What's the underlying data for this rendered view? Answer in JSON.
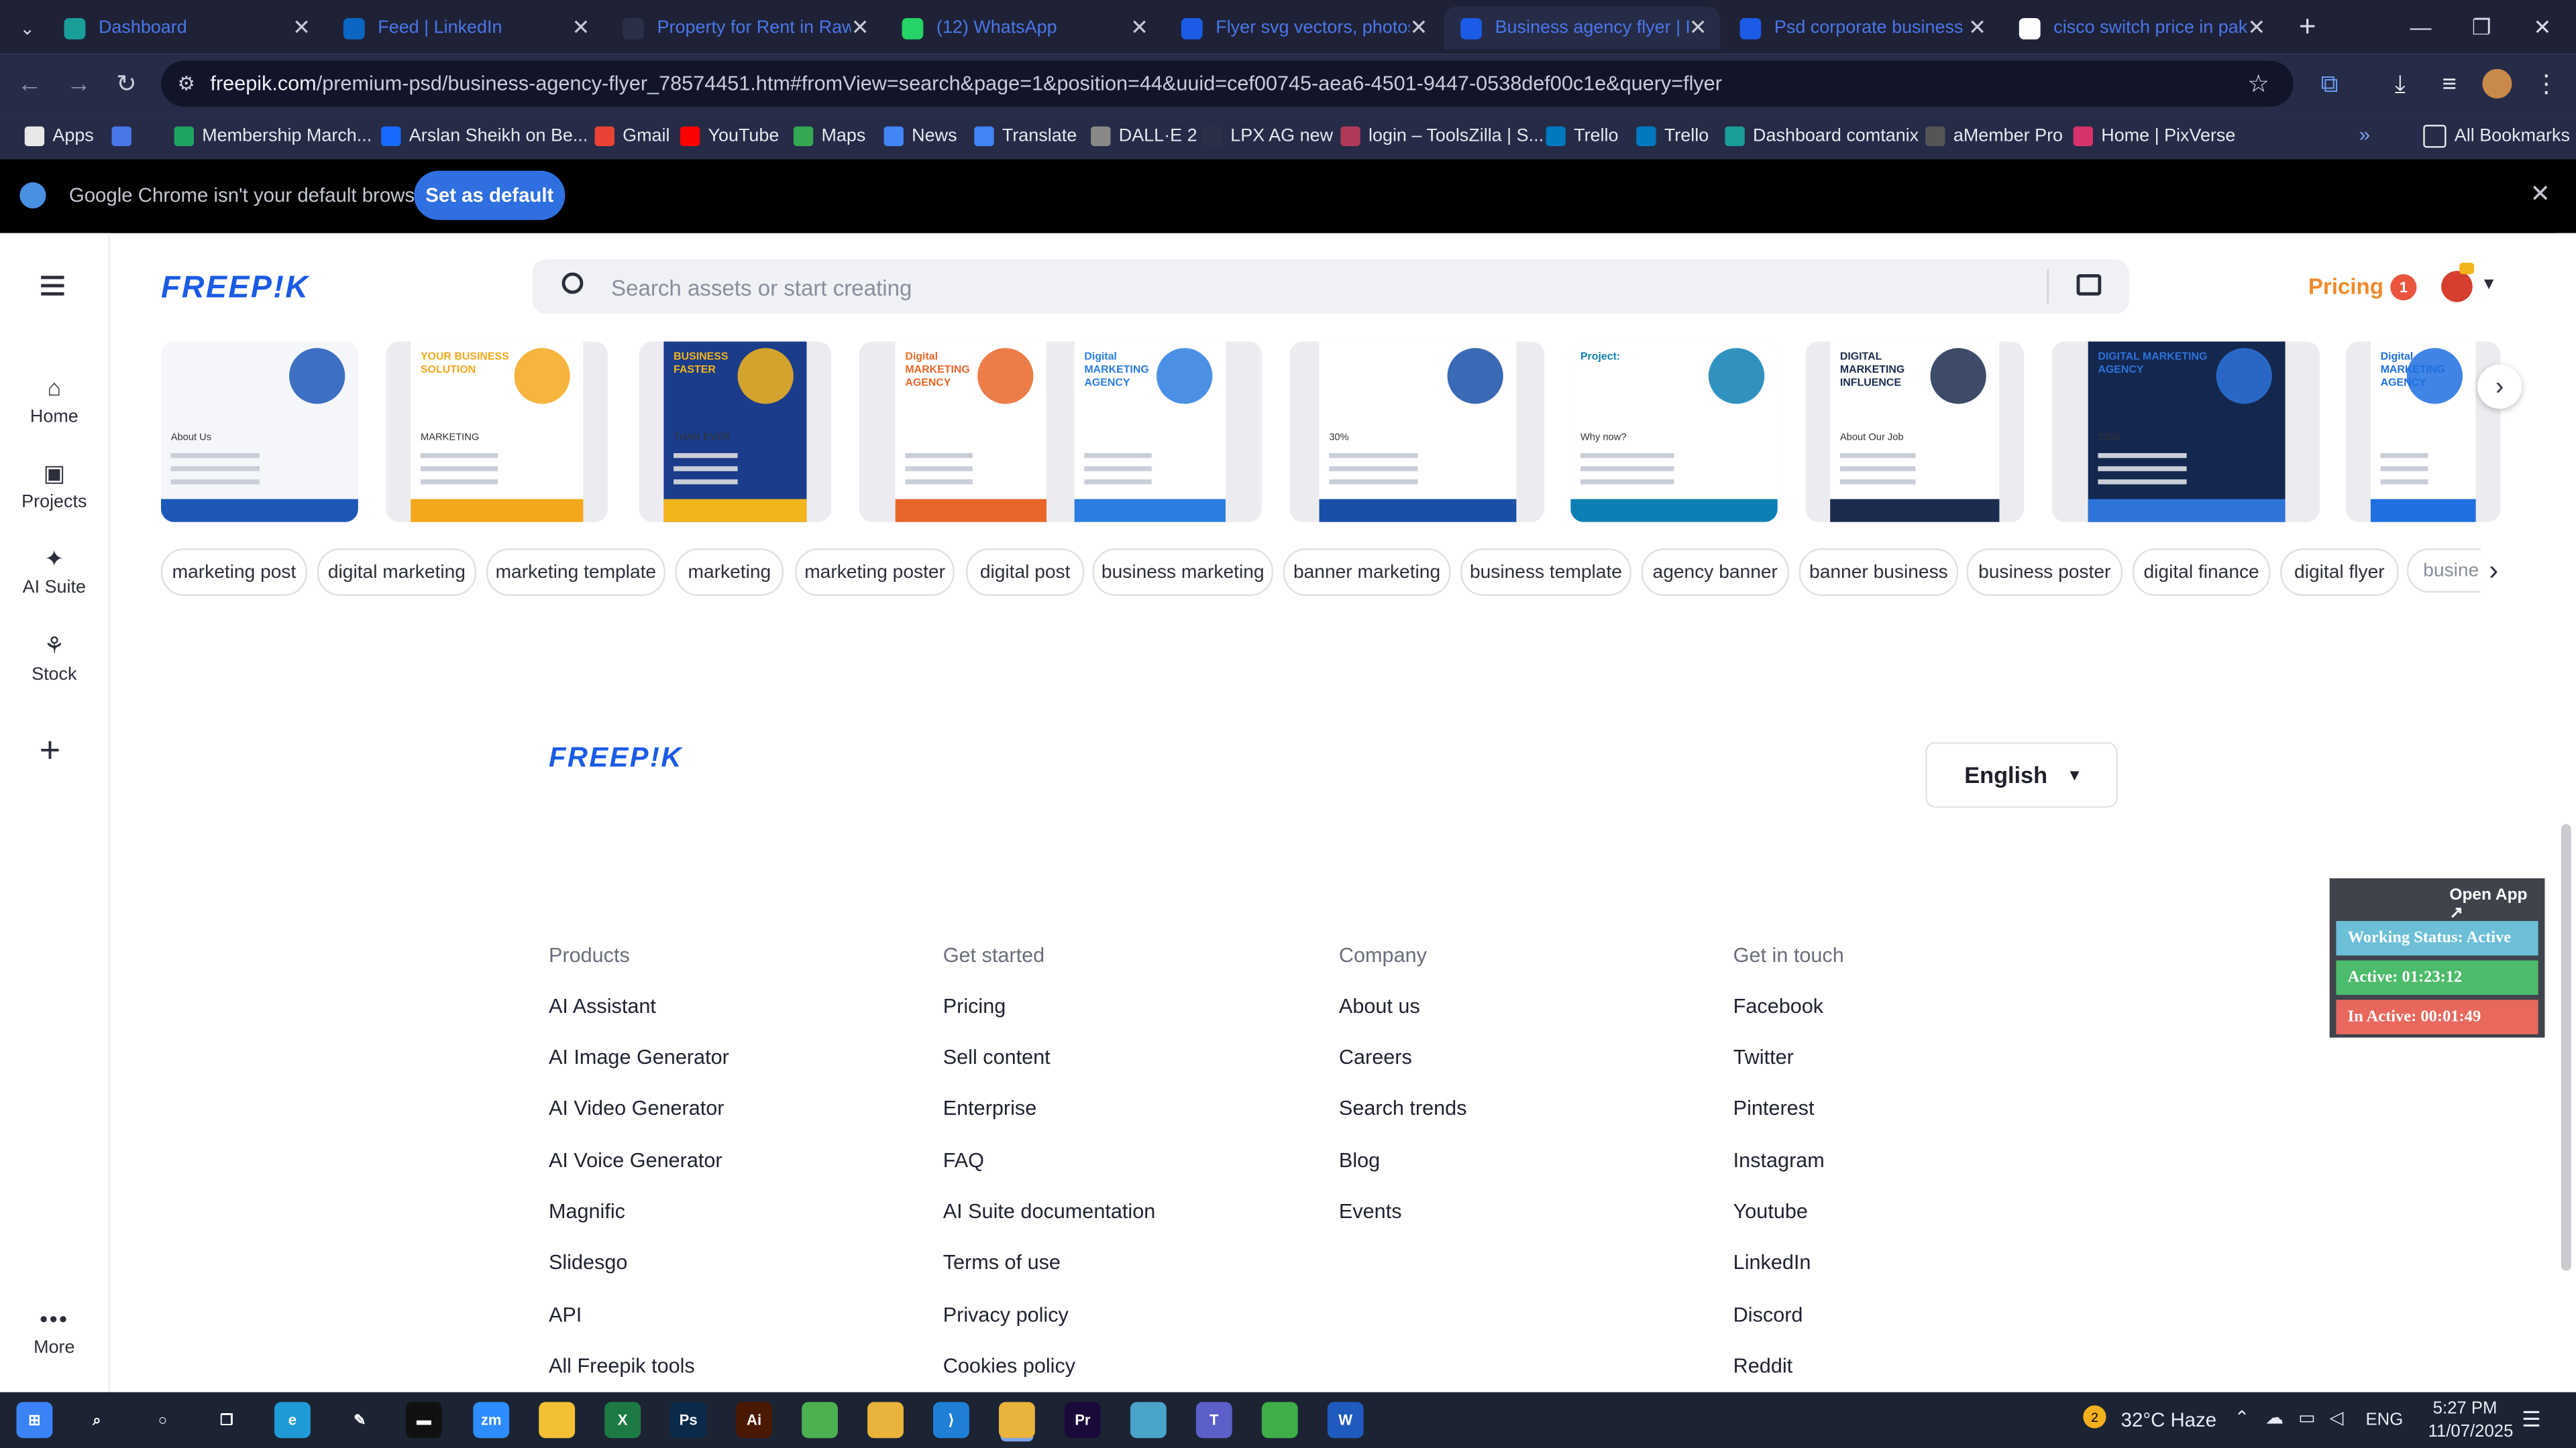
{
  "browser": {
    "tabs": [
      {
        "title": "Dashboard",
        "icon": "dashboard-favicon",
        "color": "#1a9e9a"
      },
      {
        "title": "Feed | LinkedIn",
        "icon": "linkedin-favicon",
        "color": "#0a66c2"
      },
      {
        "title": "Property for Rent in Rawa",
        "icon": "zameen-favicon",
        "color": "#2b2f48"
      },
      {
        "title": "(12) WhatsApp",
        "icon": "whatsapp-favicon",
        "color": "#25d366"
      },
      {
        "title": "Flyer svg vectors, photos",
        "icon": "freepik-favicon",
        "color": "#1b5be6"
      },
      {
        "title": "Business agency flyer | Pr",
        "icon": "freepik-favicon",
        "color": "#1b5be6"
      },
      {
        "title": "Psd corporate business fl",
        "icon": "freepik-favicon",
        "color": "#1b5be6"
      },
      {
        "title": "cisco switch price in paki",
        "icon": "google-favicon",
        "color": "#ffffff"
      }
    ],
    "url_host": "freepik.com",
    "url_path": "/premium-psd/business-agency-flyer_78574451.htm#fromView=search&page=1&position=44&uuid=cef00745-aea6-4501-9447-0538def00c1e&query=flyer",
    "bookmarks": [
      {
        "label": "Apps",
        "color": "#e8e8e8"
      },
      {
        "label": "",
        "color": "#4a76e8"
      },
      {
        "label": "Membership March...",
        "color": "#1fa463"
      },
      {
        "label": "Arslan Sheikh on Be...",
        "color": "#1769ff"
      },
      {
        "label": "Gmail",
        "color": "#ea4335"
      },
      {
        "label": "YouTube",
        "color": "#ff0000"
      },
      {
        "label": "Maps",
        "color": "#34a853"
      },
      {
        "label": "News",
        "color": "#4285f4"
      },
      {
        "label": "Translate",
        "color": "#4285f4"
      },
      {
        "label": "DALL·E 2",
        "color": "#888888"
      },
      {
        "label": "LPX AG new",
        "color": "#2b2f48"
      },
      {
        "label": "login – ToolsZilla | S...",
        "color": "#b13a5a"
      },
      {
        "label": "Trello",
        "color": "#0079bf"
      },
      {
        "label": "Trello",
        "color": "#0079bf"
      },
      {
        "label": "Dashboard comtanix",
        "color": "#1a9e9a"
      },
      {
        "label": "aMember Pro",
        "color": "#555555"
      },
      {
        "label": "Home | PixVerse",
        "color": "#d6336c"
      }
    ],
    "all_bookmarks": "All Bookmarks",
    "infobar_text": "Google Chrome isn't your default browser",
    "set_default": "Set as default"
  },
  "sidebar": {
    "items": [
      {
        "label": "Home",
        "icon": "home-icon"
      },
      {
        "label": "Projects",
        "icon": "projects-icon"
      },
      {
        "label": "AI Suite",
        "icon": "ai-suite-icon"
      },
      {
        "label": "Stock",
        "icon": "stock-icon"
      }
    ],
    "more": "More"
  },
  "header": {
    "logo": "FREEP!K",
    "search_placeholder": "Search assets or start creating",
    "pricing": "Pricing",
    "notification_count": "1"
  },
  "flyer_cards": [
    {
      "palette": [
        "#f4f6fa",
        "#1d57b8"
      ],
      "heading": "",
      "text": "About Us"
    },
    {
      "palette": [
        "#ffffff",
        "#f3a81c"
      ],
      "heading": "YOUR BUSINESS SOLUTION",
      "text": "MARKETING"
    },
    {
      "palette": [
        "#1a3c8a",
        "#f3b51c"
      ],
      "heading": "BUSINESS FASTER",
      "text": "THAN EVER"
    },
    {
      "palette": [
        "#ffffff",
        "#e9662a"
      ],
      "heading": "Digital MARKETING AGENCY",
      "text": ""
    },
    {
      "palette": [
        "#ffffff",
        "#2b7de0"
      ],
      "heading": "Digital MARKETING AGENCY",
      "text": ""
    },
    {
      "palette": [
        "#ffffff",
        "#1a4fa8"
      ],
      "heading": "",
      "text": "30%"
    },
    {
      "palette": [
        "#ffffff",
        "#0e7fb4"
      ],
      "heading": "Project:",
      "text": "Why now?"
    },
    {
      "palette": [
        "#ffffff",
        "#1b2c4f"
      ],
      "heading": "DIGITAL MARKETING INFLUENCE",
      "text": "About Our Job"
    },
    {
      "palette": [
        "#13274f",
        "#2e73d8"
      ],
      "heading": "DIGITAL MARKETING AGENCY",
      "text": "2050"
    },
    {
      "palette": [
        "#ffffff",
        "#1f6fe0"
      ],
      "heading": "Digital MARKETING AGENCY",
      "text": ""
    }
  ],
  "tags": [
    "marketing post",
    "digital marketing",
    "marketing template",
    "marketing",
    "marketing poster",
    "digital post",
    "business marketing",
    "banner marketing",
    "business template",
    "agency banner",
    "banner business",
    "business poster",
    "digital finance",
    "digital flyer",
    "busine"
  ],
  "footer": {
    "logo": "FREEP!K",
    "language": "English",
    "columns": [
      {
        "heading": "Products",
        "links": [
          "AI Assistant",
          "AI Image Generator",
          "AI Video Generator",
          "AI Voice Generator",
          "Magnific",
          "Slidesgo",
          "API",
          "All Freepik tools"
        ]
      },
      {
        "heading": "Get started",
        "links": [
          "Pricing",
          "Sell content",
          "Enterprise",
          "FAQ",
          "AI Suite documentation",
          "Terms of use",
          "Privacy policy",
          "Cookies policy"
        ]
      },
      {
        "heading": "Company",
        "links": [
          "About us",
          "Careers",
          "Search trends",
          "Blog",
          "Events"
        ]
      },
      {
        "heading": "Get in touch",
        "links": [
          "Facebook",
          "Twitter",
          "Pinterest",
          "Instagram",
          "Youtube",
          "LinkedIn",
          "Discord",
          "Reddit"
        ]
      }
    ]
  },
  "widget": {
    "open_app": "Open App ↗",
    "status": "Working Status: Active",
    "active": "Active: 01:23:12",
    "inactive": "In Active: 00:01:49",
    "colors": {
      "status": "#6cbfd7",
      "active": "#4cbb6c",
      "inactive": "#e8685e"
    }
  },
  "taskbar": {
    "apps": [
      {
        "name": "start-icon",
        "color": "#3b82f6"
      },
      {
        "name": "search-icon",
        "color": "#1c2333"
      },
      {
        "name": "cortana-icon",
        "color": "#1c2333"
      },
      {
        "name": "task-view-icon",
        "color": "#1c2333"
      },
      {
        "name": "edge-icon",
        "color": "#1f9ad6"
      },
      {
        "name": "pen-icon",
        "color": "#1c2333"
      },
      {
        "name": "terminal-icon",
        "color": "#111111"
      },
      {
        "name": "zoom-icon",
        "color": "#2d8cff"
      },
      {
        "name": "file-explorer-icon",
        "color": "#f3c033"
      },
      {
        "name": "excel-icon",
        "color": "#1d7a45"
      },
      {
        "name": "photoshop-icon",
        "color": "#0b2a4a"
      },
      {
        "name": "illustrator-icon",
        "color": "#4a1a00"
      },
      {
        "name": "green-app-icon",
        "color": "#4caf50"
      },
      {
        "name": "chrome-icon",
        "color": "#e9b33c"
      },
      {
        "name": "vscode-icon",
        "color": "#1f7fd4"
      },
      {
        "name": "chrome-active-icon",
        "color": "#e9b33c"
      },
      {
        "name": "premiere-icon",
        "color": "#1a0a3a"
      },
      {
        "name": "blue-app-icon",
        "color": "#4aa3c8"
      },
      {
        "name": "teams-icon",
        "color": "#5b5fc7"
      },
      {
        "name": "green-app-2-icon",
        "color": "#3fae49"
      },
      {
        "name": "word-icon",
        "color": "#1f5bbd"
      }
    ],
    "weather": "32°C  Haze",
    "lang": "ENG",
    "time": "5:27 PM",
    "date": "11/07/2025",
    "notif": "2"
  }
}
